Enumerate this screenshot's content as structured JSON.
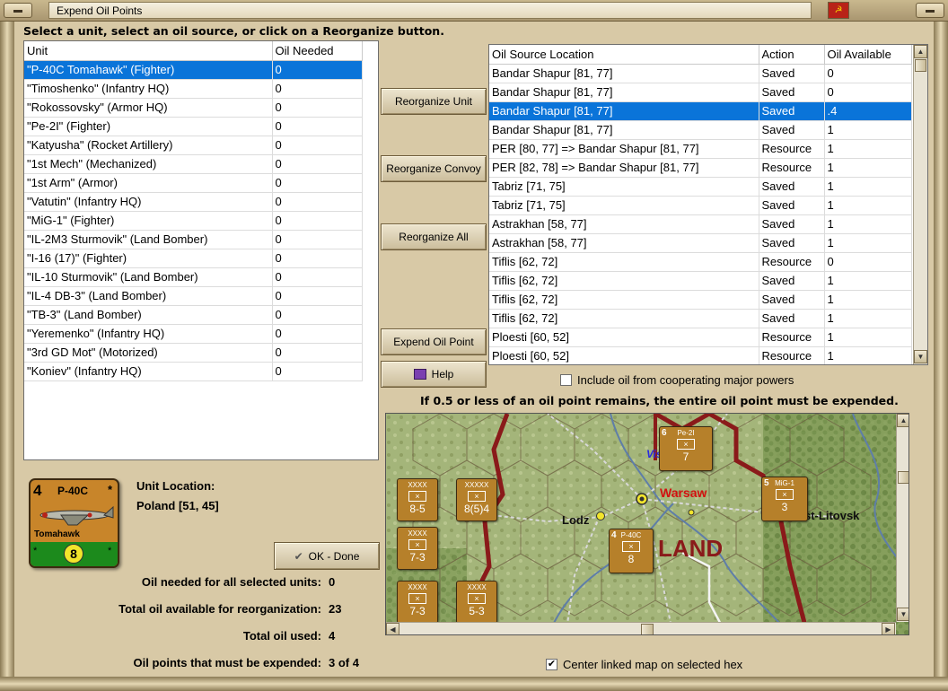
{
  "window": {
    "title": "Expend Oil Points"
  },
  "instruction": "Select a unit, select an oil source, or click on a Reorganize button.",
  "units_table": {
    "headers": [
      "Unit",
      "Oil Needed"
    ],
    "rows": [
      {
        "unit": "\"P-40C Tomahawk\" (Fighter)",
        "oil": "0",
        "selected": true
      },
      {
        "unit": "\"Timoshenko\" (Infantry HQ)",
        "oil": "0"
      },
      {
        "unit": "\"Rokossovsky\" (Armor HQ)",
        "oil": "0"
      },
      {
        "unit": "\"Pe-2I\" (Fighter)",
        "oil": "0"
      },
      {
        "unit": "\"Katyusha\" (Rocket Artillery)",
        "oil": "0"
      },
      {
        "unit": "\"1st Mech\" (Mechanized)",
        "oil": "0"
      },
      {
        "unit": "\"1st Arm\" (Armor)",
        "oil": "0"
      },
      {
        "unit": "\"Vatutin\" (Infantry HQ)",
        "oil": "0"
      },
      {
        "unit": "\"MiG-1\" (Fighter)",
        "oil": "0"
      },
      {
        "unit": "\"IL-2M3 Sturmovik\" (Land Bomber)",
        "oil": "0"
      },
      {
        "unit": "\"I-16 (17)\" (Fighter)",
        "oil": "0"
      },
      {
        "unit": "\"IL-10 Sturmovik\" (Land Bomber)",
        "oil": "0"
      },
      {
        "unit": "\"IL-4 DB-3\" (Land Bomber)",
        "oil": "0"
      },
      {
        "unit": "\"TB-3\" (Land Bomber)",
        "oil": "0"
      },
      {
        "unit": "\"Yeremenko\" (Infantry HQ)",
        "oil": "0"
      },
      {
        "unit": "\"3rd GD Mot\" (Motorized)",
        "oil": "0"
      },
      {
        "unit": "\"Koniev\" (Infantry HQ)",
        "oil": "0"
      }
    ]
  },
  "buttons": {
    "reorganize_unit": "Reorganize Unit",
    "reorganize_convoy": "Reorganize Convoy",
    "reorganize_all": "Reorganize All",
    "expend_oil_point": "Expend Oil Point",
    "help": "Help",
    "ok_done": "OK - Done"
  },
  "sources_table": {
    "headers": [
      "Oil Source Location",
      "Action",
      "Oil Available"
    ],
    "rows": [
      {
        "loc": "Bandar Shapur [81, 77]",
        "action": "Saved",
        "avail": "0"
      },
      {
        "loc": "Bandar Shapur [81, 77]",
        "action": "Saved",
        "avail": "0"
      },
      {
        "loc": "Bandar Shapur [81, 77]",
        "action": "Saved",
        "avail": ".4",
        "selected": true
      },
      {
        "loc": "Bandar Shapur [81, 77]",
        "action": "Saved",
        "avail": "1"
      },
      {
        "loc": "PER [80, 77] => Bandar Shapur [81, 77]",
        "action": "Resource",
        "avail": "1"
      },
      {
        "loc": "PER [82, 78] => Bandar Shapur [81, 77]",
        "action": "Resource",
        "avail": "1"
      },
      {
        "loc": "Tabriz [71, 75]",
        "action": "Saved",
        "avail": "1"
      },
      {
        "loc": "Tabriz [71, 75]",
        "action": "Saved",
        "avail": "1"
      },
      {
        "loc": "Astrakhan [58, 77]",
        "action": "Saved",
        "avail": "1"
      },
      {
        "loc": "Astrakhan [58, 77]",
        "action": "Saved",
        "avail": "1"
      },
      {
        "loc": "Tiflis [62, 72]",
        "action": "Resource",
        "avail": "0"
      },
      {
        "loc": "Tiflis [62, 72]",
        "action": "Saved",
        "avail": "1"
      },
      {
        "loc": "Tiflis [62, 72]",
        "action": "Saved",
        "avail": "1"
      },
      {
        "loc": "Tiflis [62, 72]",
        "action": "Saved",
        "avail": "1"
      },
      {
        "loc": "Ploesti [60, 52]",
        "action": "Resource",
        "avail": "1"
      },
      {
        "loc": "Ploesti [60, 52]",
        "action": "Resource",
        "avail": "1"
      }
    ]
  },
  "include_coop": {
    "label": "Include oil from cooperating major powers",
    "checked": false
  },
  "rule_note": "If 0.5 or less of an oil point remains, the entire oil point must be expended.",
  "counter": {
    "strength": "4",
    "name": "P-40C",
    "subname": "Tomahawk",
    "star": "*",
    "movement": "8"
  },
  "location": {
    "label": "Unit Location:",
    "value": "Poland [51, 45]"
  },
  "stats": [
    {
      "label": "Oil needed for all selected units:",
      "value": "0"
    },
    {
      "label": "Total oil available for reorganization:",
      "value": "23"
    },
    {
      "label": "Total oil used:",
      "value": "4"
    },
    {
      "label": "Oil points that must be expended:",
      "value": "3 of 4"
    }
  ],
  "map": {
    "labels": {
      "warsaw": "Warsaw",
      "lodz": "Lodz",
      "vistula": "Vist",
      "poland": "LAND",
      "brest": "st-Litovsk"
    },
    "units": [
      {
        "name": "Pe-2I",
        "top": "6",
        "bottom": "7"
      },
      {
        "name": "MiG-1",
        "top": "5",
        "bottom": "3"
      },
      {
        "name": "P-40C",
        "top": "4",
        "bottom": "8"
      },
      {
        "name": "XXXX",
        "top": "",
        "bottom": "8-5"
      },
      {
        "name": "XXXXX",
        "top": "",
        "bottom": "8(5)4"
      },
      {
        "name": "XXXX",
        "top": "",
        "bottom": "7-3"
      },
      {
        "name": "XXXX",
        "top": "",
        "bottom": "7-3"
      },
      {
        "name": "XXXX",
        "top": "",
        "bottom": "5-3"
      }
    ]
  },
  "center_linked": {
    "label": "Center linked map on selected hex",
    "checked": true
  }
}
